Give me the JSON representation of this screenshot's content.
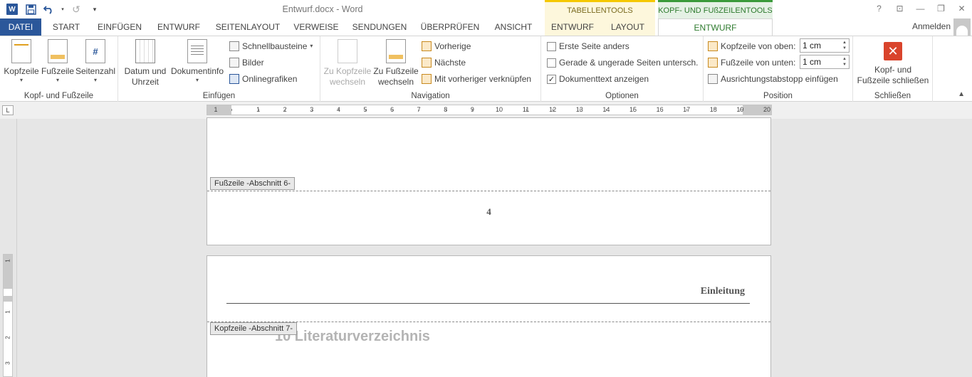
{
  "window": {
    "title": "Entwurf.docx - Word",
    "controls": [
      "?",
      "⊡",
      "—",
      "❐",
      "✕"
    ]
  },
  "qat": {
    "undo_icon": "undo-icon",
    "redo_icon": "redo-icon"
  },
  "context_tabs": {
    "table_tools": "TABELLENTOOLS",
    "header_footer_tools": "KOPF- UND FUßZEILENTOOLS"
  },
  "tabs": [
    "DATEI",
    "START",
    "EINFÜGEN",
    "ENTWURF",
    "SEITENLAYOUT",
    "VERWEISE",
    "SENDUNGEN",
    "ÜBERPRÜFEN",
    "ANSICHT",
    "ENTWURF",
    "LAYOUT",
    "ENTWURF"
  ],
  "signin": "Anmelden",
  "ribbon": {
    "group_kopf": {
      "label": "Kopf- und Fußzeile",
      "kopfzeile": "Kopfzeile",
      "fusszeile": "Fußzeile",
      "seitenzahl": "Seitenzahl"
    },
    "group_einfuegen": {
      "label": "Einfügen",
      "datum_line1": "Datum und",
      "datum_line2": "Uhrzeit",
      "dokumentinfo": "Dokumentinfo",
      "schnellbausteine": "Schnellbausteine",
      "bilder": "Bilder",
      "onlinegrafiken": "Onlinegrafiken"
    },
    "group_navigation": {
      "label": "Navigation",
      "zu_kopf_line1": "Zu Kopfzeile",
      "zu_kopf_line2": "wechseln",
      "zu_fuss_line1": "Zu Fußzeile",
      "zu_fuss_line2": "wechseln",
      "vorherige": "Vorherige",
      "naechste": "Nächste",
      "verknuepfen": "Mit vorheriger verknüpfen"
    },
    "group_optionen": {
      "label": "Optionen",
      "erste_seite": "Erste Seite anders",
      "gerade_ungerade": "Gerade & ungerade Seiten untersch.",
      "dokumenttext": "Dokumenttext anzeigen",
      "erste_seite_checked": false,
      "gerade_ungerade_checked": false,
      "dokumenttext_checked": true,
      "check_mark": "✓"
    },
    "group_position": {
      "label": "Position",
      "kopf_von_oben": "Kopfzeile von oben:",
      "fuss_von_unten": "Fußzeile von unten:",
      "kopf_value": "1  cm",
      "fuss_value": "1  cm",
      "ausrichtung": "Ausrichtungstabstopp einfügen"
    },
    "group_schliessen": {
      "label": "Schließen",
      "close_line1": "Kopf- und",
      "close_line2": "Fußzeile schließen"
    }
  },
  "ruler": {
    "numbers": [
      "1",
      "1",
      "2",
      "3",
      "4",
      "5",
      "6",
      "7",
      "8",
      "9",
      "10",
      "11",
      "12",
      "13",
      "14",
      "15",
      "16",
      "17",
      "18",
      "19",
      "20"
    ],
    "vertical_numbers": [
      "1",
      "1",
      "2",
      "3"
    ]
  },
  "document": {
    "footer_tag": "Fußzeile -Abschnitt 6-",
    "page_number": "4",
    "header_tag": "Kopfzeile -Abschnitt 7-",
    "running_head": "Einleitung",
    "chapter_heading": "10  Literaturverzeichnis"
  },
  "colors": {
    "word_blue": "#2b579a",
    "context_table": "#f5c800",
    "context_header": "#3a9a3a",
    "close_red": "#d9442c"
  }
}
